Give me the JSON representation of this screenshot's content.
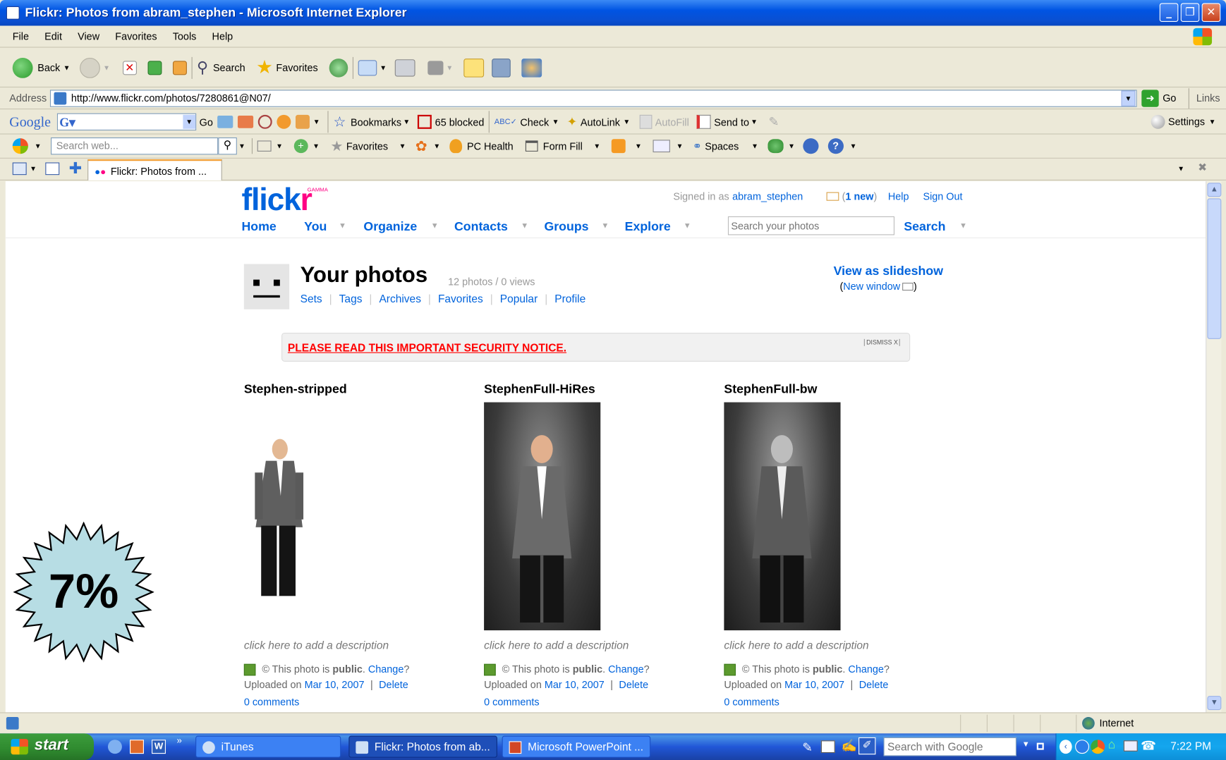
{
  "window": {
    "title": "Flickr: Photos from abram_stephen - Microsoft Internet Explorer"
  },
  "menu": [
    "File",
    "Edit",
    "View",
    "Favorites",
    "Tools",
    "Help"
  ],
  "std_toolbar": {
    "back": "Back",
    "search": "Search",
    "favorites": "Favorites"
  },
  "address": {
    "label": "Address",
    "url": "http://www.flickr.com/photos/7280861@N07/",
    "go": "Go",
    "links": "Links"
  },
  "google_toolbar": {
    "logo": "Google",
    "go": "Go",
    "bookmarks": "Bookmarks",
    "blocked": "65 blocked",
    "check": "Check",
    "autolink": "AutoLink",
    "autofill": "AutoFill",
    "sendto": "Send to",
    "settings": "Settings"
  },
  "msn_toolbar": {
    "search_placeholder": "Search web...",
    "favorites": "Favorites",
    "pchealth": "PC Health",
    "formfill": "Form Fill",
    "spaces": "Spaces"
  },
  "tab": {
    "label": "Flickr: Photos from ..."
  },
  "flickr": {
    "logo": "flickr",
    "beta": "GAMMA",
    "signed_in_prefix": "Signed in as",
    "user": "abram_stephen",
    "mail_open": "(",
    "mail_count": "1 new",
    "mail_close": ")",
    "help": "Help",
    "sign_out": "Sign Out",
    "nav": [
      "Home",
      "You",
      "Organize",
      "Contacts",
      "Groups",
      "Explore"
    ],
    "search_placeholder": "Search your photos",
    "search_button": "Search",
    "page_title": "Your photos",
    "stats": "12 photos / 0 views",
    "subnav": [
      "Sets",
      "Tags",
      "Archives",
      "Favorites",
      "Popular",
      "Profile"
    ],
    "slideshow": "View as slideshow",
    "new_window": "New window",
    "notice": "PLEASE READ THIS IMPORTANT SECURITY NOTICE.",
    "dismiss": "DISMISS X",
    "photos": [
      {
        "title": "Stephen-stripped",
        "desc": "click here to add a description",
        "public_prefix": "© This photo is",
        "public": "public",
        "change": "Change",
        "uploaded": "Uploaded on",
        "date": "Mar 10, 2007",
        "delete": "Delete",
        "comments": "0 comments"
      },
      {
        "title": "StephenFull-HiRes",
        "desc": "click here to add a description",
        "public_prefix": "© This photo is",
        "public": "public",
        "change": "Change",
        "uploaded": "Uploaded on",
        "date": "Mar 10, 2007",
        "delete": "Delete",
        "comments": "0 comments"
      },
      {
        "title": "StephenFull-bw",
        "desc": "click here to add a description",
        "public_prefix": "© This photo is",
        "public": "public",
        "change": "Change",
        "uploaded": "Uploaded on",
        "date": "Mar 10, 2007",
        "delete": "Delete",
        "comments": "0 comments"
      }
    ]
  },
  "overlay": {
    "percent": "7%"
  },
  "status": {
    "zone": "Internet"
  },
  "taskbar": {
    "start": "start",
    "items": [
      "iTunes",
      "Flickr: Photos from ab...",
      "Microsoft PowerPoint ..."
    ],
    "search_placeholder": "Search with Google",
    "clock": "7:22 PM"
  }
}
